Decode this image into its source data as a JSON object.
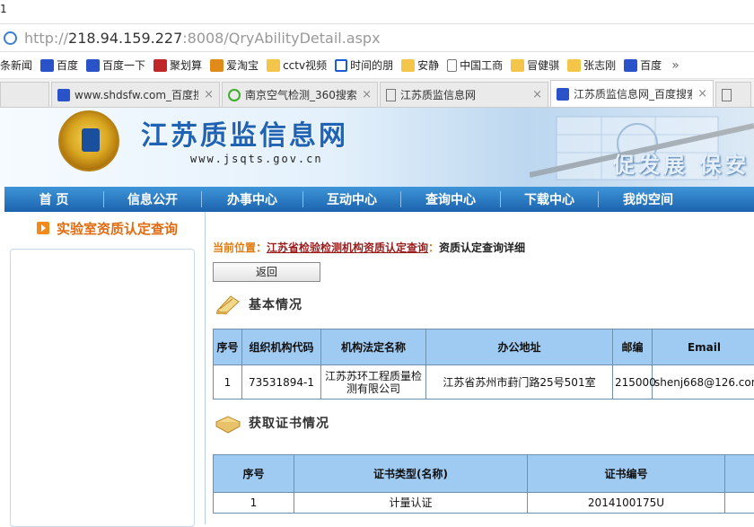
{
  "window": {
    "title_fragment": "1"
  },
  "address": {
    "scheme": "http://",
    "host": "218.94.159.227",
    "rest": ":8008/QryAbilityDetail.aspx"
  },
  "bookmarks": [
    {
      "label": "条新闻",
      "icon": "none"
    },
    {
      "label": "百度",
      "icon": "paw"
    },
    {
      "label": "百度一下",
      "icon": "paw"
    },
    {
      "label": "聚划算",
      "icon": "ju"
    },
    {
      "label": "爱淘宝",
      "icon": "taobao"
    },
    {
      "label": "cctv视频",
      "icon": "folder"
    },
    {
      "label": "时间的朋",
      "icon": "play"
    },
    {
      "label": "安静",
      "icon": "folder"
    },
    {
      "label": "中国工商",
      "icon": "doc"
    },
    {
      "label": "冒健骐",
      "icon": "folder"
    },
    {
      "label": "张志刚",
      "icon": "folder"
    },
    {
      "label": "百度",
      "icon": "paw"
    }
  ],
  "bookmarks_more": "»",
  "tabs": [
    {
      "label": "",
      "icon": "none"
    },
    {
      "label": "www.shdsfw.com_百度搜",
      "icon": "paw"
    },
    {
      "label": "南京空气检测_360搜索",
      "icon": "360"
    },
    {
      "label": "江苏质监信息网",
      "icon": "doc"
    },
    {
      "label": "江苏质监信息网_百度搜索",
      "icon": "paw"
    },
    {
      "label": "",
      "icon": "doc"
    }
  ],
  "site": {
    "title": "江苏质监信息网",
    "domain": "www.jsqts.gov.cn",
    "slogan": "促发展 保安"
  },
  "nav": [
    "首 页",
    "信息公开",
    "办事中心",
    "互动中心",
    "查询中心",
    "下载中心",
    "我的空间"
  ],
  "sidebar": {
    "title": "实验室资质认定查询"
  },
  "breadcrumb": {
    "label": "当前位置：",
    "link": "江苏省检验检测机构资质认定查询",
    "separator": "：",
    "current": "资质认定查询详细"
  },
  "back_button": "返回",
  "basic": {
    "title": "基本情况",
    "headers": [
      "序号",
      "组织机构代码",
      "机构法定名称",
      "办公地址",
      "邮编",
      "Email"
    ],
    "rows": [
      [
        "1",
        "73531894-1",
        "江苏苏环工程质量检测有限公司",
        "江苏省苏州市葑门路25号501室",
        "215000",
        "shenj668@126.com"
      ]
    ]
  },
  "cert": {
    "title": "获取证书情况",
    "headers": [
      "序号",
      "证书类型(名称)",
      "证书编号",
      ""
    ],
    "rows": [
      [
        "1",
        "计量认证",
        "2014100175U",
        ""
      ]
    ]
  }
}
